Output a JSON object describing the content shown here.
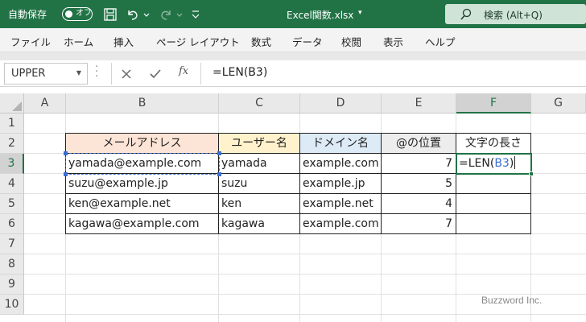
{
  "titlebar": {
    "autosave_label": "自動保存",
    "toggle_label": "オフ",
    "file_title": "Excel関数.xlsx",
    "title_caret": "▾",
    "search_placeholder": "検索 (Alt+Q)",
    "bg_color": "#217346"
  },
  "ribbon": {
    "tabs": [
      "ファイル",
      "ホーム",
      "挿入",
      "ページ レイアウト",
      "数式",
      "データ",
      "校閲",
      "表示",
      "ヘルプ"
    ]
  },
  "formula_bar": {
    "name_box": "UPPER",
    "fx_label": "fx",
    "content": "=LEN(B3)"
  },
  "grid": {
    "columns": [
      "A",
      "B",
      "C",
      "D",
      "E",
      "F",
      "G"
    ],
    "rows": [
      "1",
      "2",
      "3",
      "4",
      "5",
      "6",
      "7",
      "8",
      "9",
      "10"
    ],
    "selected_column": "F",
    "selected_row": "3",
    "table": {
      "headers": [
        "メールアドレス",
        "ユーザー名",
        "ドメイン名",
        "@の位置",
        "文字の長さ"
      ],
      "header_colors": [
        "#fce4d6",
        "#fff2cc",
        "#ddebf7",
        "#ededed",
        "#ffffff"
      ],
      "rows": [
        [
          "yamada@example.com",
          "yamada",
          "example.com",
          "7",
          "=LEN(B3)"
        ],
        [
          "suzu@example.jp",
          "suzu",
          "example.jp",
          "5",
          ""
        ],
        [
          "ken@example.net",
          "ken",
          "example.net",
          "4",
          ""
        ],
        [
          "kagawa@example.com",
          "kagawa",
          "example.com",
          "7",
          ""
        ]
      ]
    },
    "edit_formula_prefix": "=LEN(",
    "edit_formula_ref": "B3",
    "edit_formula_suffix": ")",
    "ref_color": "#3a6ed1",
    "accent_color": "#217346"
  },
  "watermark": "Buzzword Inc."
}
